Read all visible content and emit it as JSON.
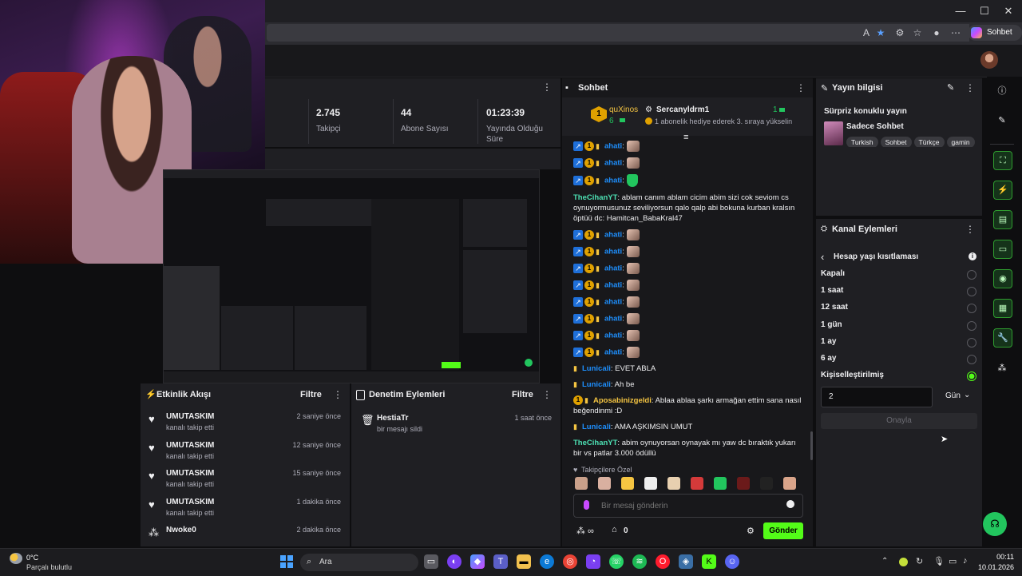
{
  "browser": {
    "copilot_label": "Sohbet et",
    "window_controls": {
      "minimize": "—",
      "maximize": "☐",
      "close": "✕"
    }
  },
  "stats": {
    "followers_value": "2.745",
    "followers_label": "Takipçi",
    "subscribers_value": "44",
    "subscribers_label": "Abone Sayısı",
    "uptime_value": "01:23:39",
    "uptime_label_1": "Yayında Olduğu",
    "uptime_label_2": "Süre"
  },
  "activity": {
    "title": "Etkinlik Akışı",
    "filter": "Filtre",
    "items": [
      {
        "name": "UMUTASKIM",
        "action": "kanalı takip etti",
        "time": "2 saniye önce"
      },
      {
        "name": "UMUTASKIM",
        "action": "kanalı takip etti",
        "time": "12 saniye önce"
      },
      {
        "name": "UMUTASKIM",
        "action": "kanalı takip etti",
        "time": "15 saniye önce"
      },
      {
        "name": "UMUTASKIM",
        "action": "kanalı takip etti",
        "time": "1 dakika önce"
      },
      {
        "name": "Nwoke0",
        "action": "",
        "time": "2 dakika önce"
      }
    ]
  },
  "moderation": {
    "title": "Denetim Eylemleri",
    "filter": "Filtre",
    "items": [
      {
        "name": "HestiaTr",
        "action": "bir mesajı sildi",
        "time": "1 saat önce"
      }
    ]
  },
  "chat": {
    "title": "Sohbet",
    "top_gifter": {
      "rank": "1",
      "name": "quXinos",
      "count": "6"
    },
    "gift_user": "Sercanyldrm1",
    "gift_count": "1",
    "gift_text": "1 abonelik hediye ederek 3. sıraya yükselin",
    "messages": [
      {
        "user": "ahati",
        "text": ":",
        "color": "blue",
        "badges": true,
        "emote": "face"
      },
      {
        "user": "ahati",
        "text": ":",
        "color": "blue",
        "badges": true,
        "emote": "face"
      },
      {
        "user": "ahati",
        "text": ":",
        "color": "blue",
        "badges": true,
        "emote": "green"
      },
      {
        "user": "TheCihanYT",
        "text": ": ablam canım ablam cicim abim sizi cok seviom cs oynuyormusunuz seviliyorsun qalo qalp abi bokuna kurban kralsın öptüü dc: Hamitcan_BabaKral47",
        "color": "teal",
        "badges": false
      },
      {
        "user": "ahati",
        "text": ":",
        "color": "blue",
        "badges": true,
        "emote": "face2"
      },
      {
        "user": "ahati",
        "text": ":",
        "color": "blue",
        "badges": true,
        "emote": "face2"
      },
      {
        "user": "ahati",
        "text": ":",
        "color": "blue",
        "badges": true,
        "emote": "face2"
      },
      {
        "user": "ahati",
        "text": ":",
        "color": "blue",
        "badges": true,
        "emote": "face2"
      },
      {
        "user": "ahati",
        "text": ":",
        "color": "blue",
        "badges": true,
        "emote": "face2"
      },
      {
        "user": "ahati",
        "text": ":",
        "color": "blue",
        "badges": true,
        "emote": "face2"
      },
      {
        "user": "ahati",
        "text": ":",
        "color": "blue",
        "badges": true,
        "emote": "face2"
      },
      {
        "user": "ahati",
        "text": ":",
        "color": "blue",
        "badges": true,
        "emote": "face2"
      },
      {
        "user": "Lunicali",
        "text": ": EVET ABLA",
        "color": "blue",
        "badges": "lock"
      },
      {
        "user": "Lunicali",
        "text": ": Ah be",
        "color": "blue",
        "badges": "lock"
      },
      {
        "user": "Aposabinizgeldi",
        "text": ": Ablaa ablaa şarkı armağan ettim sana nasıl beğendinmi :D",
        "color": "yellow",
        "badges": "numlock"
      },
      {
        "user": "Lunicali",
        "text": ": AMA AŞKIMSIN UMUT",
        "color": "blue",
        "badges": "lock"
      },
      {
        "user": "TheCihanYT",
        "text": ": abim oynuyorsan oynayak mı yaw dc bıraktık yukarı bir vs patlar 3.000 ödüllü",
        "color": "teal",
        "badges": false
      }
    ],
    "follower_emotes_label": "Takipçilere Özel",
    "input_placeholder": "Bir mesaj gönderin",
    "viewers_count": "0",
    "send_label": "Gönder"
  },
  "stream_info": {
    "title": "Yayın bilgisi",
    "stream_title": "Sürpriz konuklu yayın",
    "category": "Sadece Sohbet",
    "tags": [
      "Turkish",
      "Sohbet",
      "Türkçe",
      "gamin"
    ]
  },
  "channel_actions": {
    "title": "Kanal Eylemleri",
    "section": "Hesap yaşı kısıtlaması",
    "options": [
      {
        "label": "Kapalı",
        "selected": false
      },
      {
        "label": "1 saat",
        "selected": false
      },
      {
        "label": "12 saat",
        "selected": false
      },
      {
        "label": "1 gün",
        "selected": false
      },
      {
        "label": "1 ay",
        "selected": false
      },
      {
        "label": "6 ay",
        "selected": false
      },
      {
        "label": "Kişiselleştirilmiş",
        "selected": true
      }
    ],
    "custom_value": "2",
    "unit": "Gün",
    "confirm_label": "Onayla"
  },
  "taskbar": {
    "weather_temp": "0°C",
    "weather_desc": "Parçalı bulutlu",
    "search_label": "Ara",
    "time": "00:11",
    "date": "10.01.2026"
  },
  "colors": {
    "accent": "#53fc18",
    "panel": "#1f1f23",
    "chat_bg": "#18181b"
  }
}
